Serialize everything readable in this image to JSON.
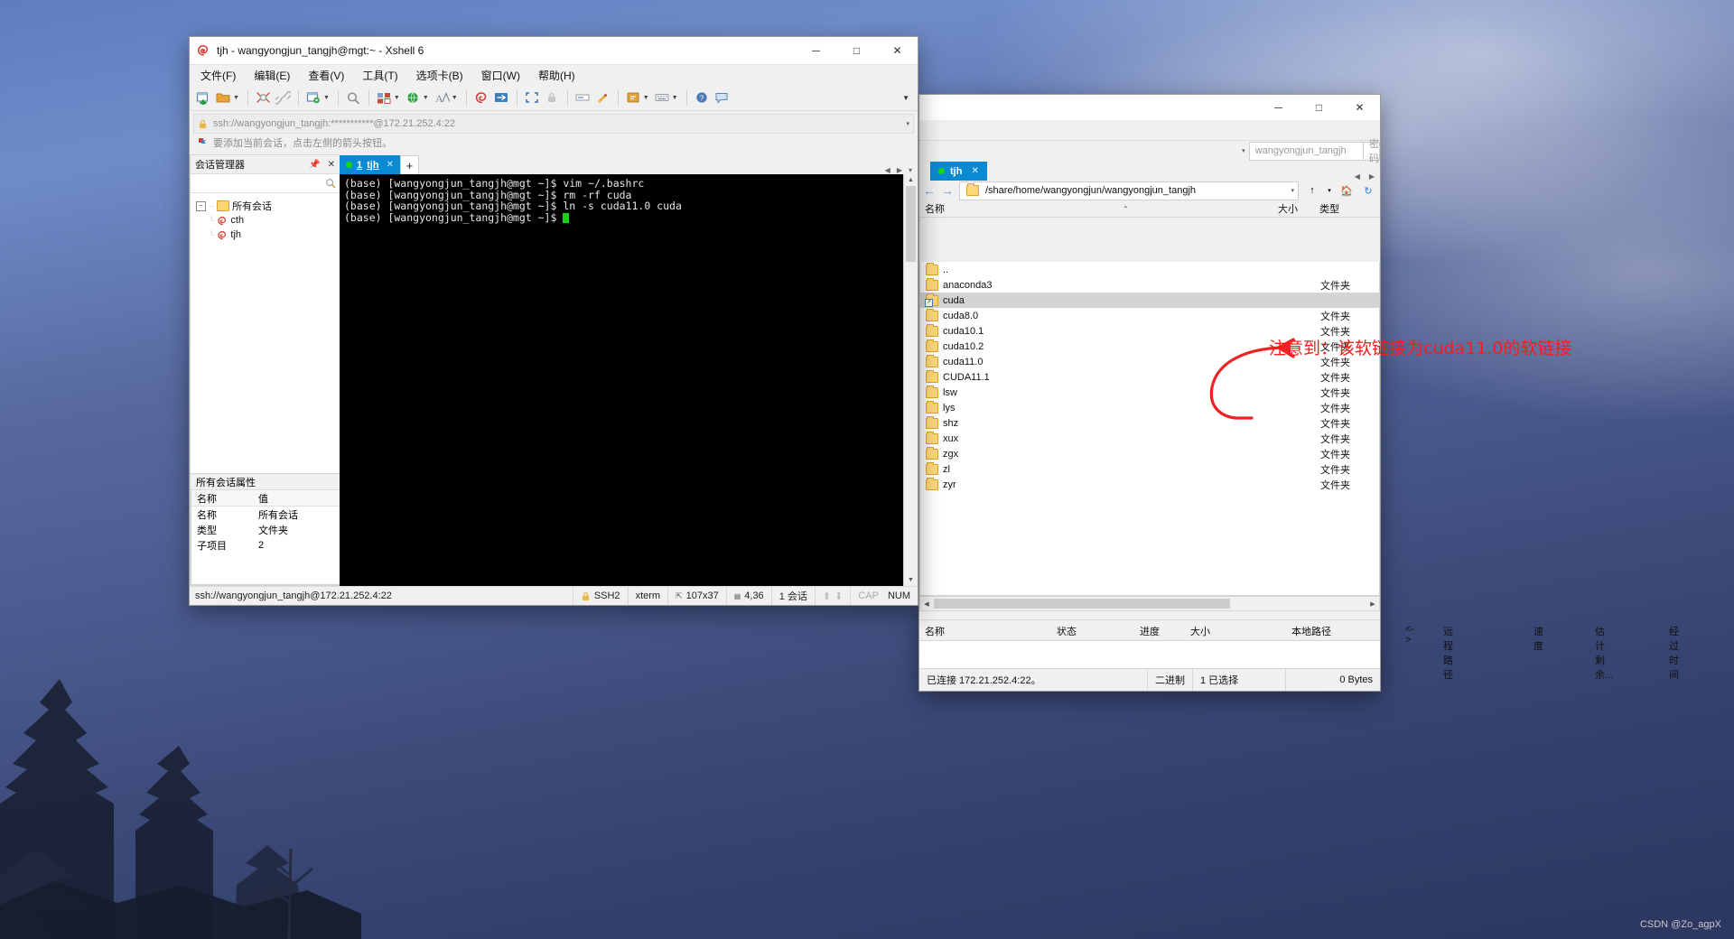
{
  "desktop": {
    "watermark": "CSDN @Zo_agpX"
  },
  "xshell": {
    "title": "tjh - wangyongjun_tangjh@mgt:~ - Xshell 6",
    "app_icon": "xshell-logo-icon",
    "window_buttons": {
      "minimize": "─",
      "maximize": "□",
      "close": "✕"
    },
    "menu": [
      "文件(F)",
      "编辑(E)",
      "查看(V)",
      "工具(T)",
      "选项卡(B)",
      "窗口(W)",
      "帮助(H)"
    ],
    "toolbar_icons": [
      "new-session-icon",
      "open-folder-icon",
      "dropdown-caret",
      "separator",
      "disconnect-icon",
      "link-icon",
      "separator",
      "session-properties-icon",
      "dropdown-caret",
      "separator",
      "find-icon",
      "separator",
      "layout-icon",
      "dropdown-caret",
      "globe-icon",
      "dropdown-caret",
      "font-icon",
      "dropdown-caret",
      "separator",
      "xshell-icon",
      "xftp-icon",
      "separator",
      "fullscreen-icon",
      "lock-icon",
      "separator",
      "compose-bar-icon",
      "highlight-icon",
      "separator",
      "script-icon",
      "dropdown-caret",
      "keymap-icon",
      "dropdown-caret",
      "separator",
      "help-icon",
      "chat-icon"
    ],
    "address_bar": {
      "lock_icon": "lock-icon",
      "url": "ssh://wangyongjun_tangjh:***********@172.21.252.4:22",
      "caret": "▾"
    },
    "hint": {
      "icon": "flag-icon",
      "text": "要添加当前会话，点击左侧的箭头按钮。"
    },
    "session_manager": {
      "title": "会话管理器",
      "pin_icon": "pin-icon",
      "close_icon": "close-icon",
      "search_icon": "search-icon",
      "tree": {
        "root": "所有会话",
        "children": [
          "cth",
          "tjh"
        ]
      },
      "properties_title": "所有会话属性",
      "properties_columns": [
        "名称",
        "值"
      ],
      "properties_rows": [
        {
          "name": "名称",
          "value": "所有会话"
        },
        {
          "name": "类型",
          "value": "文件夹"
        },
        {
          "name": "子项目",
          "value": "2"
        }
      ]
    },
    "tabs": {
      "active": {
        "index": "1",
        "label": "tjh",
        "status_dot": "green"
      },
      "add_label": "+",
      "nav": [
        "◀",
        "▶",
        "▾"
      ]
    },
    "terminal": {
      "lines": [
        "(base) [wangyongjun_tangjh@mgt ~]$ vim ~/.bashrc",
        "(base) [wangyongjun_tangjh@mgt ~]$ rm -rf cuda",
        "(base) [wangyongjun_tangjh@mgt ~]$ ln -s cuda11.0 cuda"
      ],
      "prompt": "(base) [wangyongjun_tangjh@mgt ~]$ ",
      "cursor_color": "#17d417",
      "bg": "#000000",
      "fg": "#e6e6e6"
    },
    "status_bar": {
      "left": "ssh://wangyongjun_tangjh@172.21.252.4:22",
      "protocol": "SSH2",
      "term_type": "xterm",
      "size_icon": "resize-icon",
      "size": "107x37",
      "cursor_icon": "cursor-pos-icon",
      "cursor_pos": "4,36",
      "sessions": "1 会话",
      "up_icon": "arrow-up-icon",
      "down_icon": "arrow-down-icon",
      "cap": "CAP",
      "num": "NUM"
    }
  },
  "winscp": {
    "window_buttons": {
      "minimize": "─",
      "maximize": "□",
      "close": "✕"
    },
    "login": {
      "user_value": "wangyongjun_tangjh",
      "password_placeholder": "密码",
      "combo_caret": "▾"
    },
    "tab": {
      "label": "tjh",
      "status_dot": "green",
      "close": "✕"
    },
    "tab_nav": [
      "◀",
      "▶"
    ],
    "path_bar": {
      "back_icon": "arrow-left-icon",
      "forward_icon": "arrow-right-icon",
      "folder_icon": "folder-icon",
      "path": "/share/home/wangyongjun/wangyongjun_tangjh",
      "caret": "▾",
      "up_icon": "arrow-up-icon",
      "up_caret": "▾",
      "home_icon": "home-folder-icon",
      "refresh_icon": "refresh-icon"
    },
    "columns": {
      "name": "名称",
      "size": "大小",
      "type": "类型",
      "sort_indicator": "⌃"
    },
    "files": [
      {
        "name": "..",
        "type": "",
        "icon": "folder-up-icon",
        "selected": false,
        "link": false
      },
      {
        "name": "anaconda3",
        "type": "文件夹",
        "icon": "folder-icon",
        "selected": false,
        "link": false
      },
      {
        "name": "cuda",
        "type": "",
        "icon": "symlink-folder-icon",
        "selected": true,
        "link": true
      },
      {
        "name": "cuda8.0",
        "type": "文件夹",
        "icon": "folder-icon",
        "selected": false,
        "link": false
      },
      {
        "name": "cuda10.1",
        "type": "文件夹",
        "icon": "folder-icon",
        "selected": false,
        "link": false
      },
      {
        "name": "cuda10.2",
        "type": "文件夹",
        "icon": "folder-icon",
        "selected": false,
        "link": false
      },
      {
        "name": "cuda11.0",
        "type": "文件夹",
        "icon": "folder-icon",
        "selected": false,
        "link": false
      },
      {
        "name": "CUDA11.1",
        "type": "文件夹",
        "icon": "folder-icon",
        "selected": false,
        "link": false
      },
      {
        "name": "lsw",
        "type": "文件夹",
        "icon": "folder-icon",
        "selected": false,
        "link": false
      },
      {
        "name": "lys",
        "type": "文件夹",
        "icon": "folder-icon",
        "selected": false,
        "link": false
      },
      {
        "name": "shz",
        "type": "文件夹",
        "icon": "folder-icon",
        "selected": false,
        "link": false
      },
      {
        "name": "xux",
        "type": "文件夹",
        "icon": "folder-icon",
        "selected": false,
        "link": false
      },
      {
        "name": "zgx",
        "type": "文件夹",
        "icon": "folder-icon",
        "selected": false,
        "link": false
      },
      {
        "name": "zl",
        "type": "文件夹",
        "icon": "folder-icon",
        "selected": false,
        "link": false
      },
      {
        "name": "zyr",
        "type": "文件夹",
        "icon": "folder-icon",
        "selected": false,
        "link": false
      }
    ],
    "transfer_columns": [
      "名称",
      "状态",
      "进度",
      "大小",
      "本地路径",
      "<->",
      "远程路径",
      "速度",
      "估计剩余...",
      "经过时间"
    ],
    "status_bar": {
      "connection": "已连接 172.21.252.4:22。",
      "mode": "二进制",
      "selection": "1 已选择",
      "bytes": "0 Bytes"
    }
  },
  "annotation": {
    "text": "注意到：该软链接为cuda11.0的软链接",
    "color": "#ff1a1a",
    "arrow_from": "cuda11.0",
    "arrow_to": "cuda"
  }
}
